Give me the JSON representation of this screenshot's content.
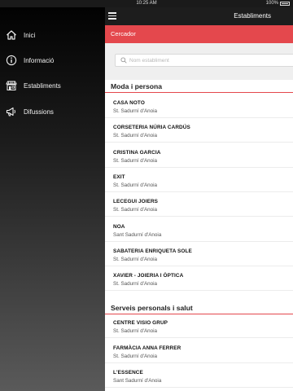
{
  "status_bar": {
    "time": "10:25 AM",
    "battery": "100%"
  },
  "sidebar": {
    "items": [
      {
        "label": "Inici",
        "icon": "home-icon"
      },
      {
        "label": "Informació",
        "icon": "info-icon"
      },
      {
        "label": "Establiments",
        "icon": "store-icon"
      },
      {
        "label": "Difussions",
        "icon": "megaphone-icon"
      }
    ]
  },
  "header": {
    "menu_icon": "hamburger-icon",
    "title": "Establiments"
  },
  "search_bar": {
    "title": "Cercador",
    "placeholder": "Nom establiment",
    "value": "",
    "icon": "search-icon"
  },
  "colors": {
    "accent": "#e4484d",
    "navbar": "#1d1d1d",
    "sidebar_top": "#020202",
    "sidebar_bottom": "#5a5a5a"
  },
  "sections": [
    {
      "title": "Moda i persona",
      "items": [
        {
          "name": "CASA NOTO",
          "location": "St. Sadurní d'Anoia"
        },
        {
          "name": "CORSETERIA NÚRIA CARDÚS",
          "location": "St. Sadurní d'Anoia"
        },
        {
          "name": "CRISTINA GARCIA",
          "location": "St. Sadurní d'Anoia"
        },
        {
          "name": "EXIT",
          "location": "St. Sadurní d'Anoia"
        },
        {
          "name": "LECEGUI JOIERS",
          "location": "St. Sadurní d'Anoia"
        },
        {
          "name": "NOA",
          "location": "Sant Sadurní d'Anoia"
        },
        {
          "name": "SABATERIA ENRIQUETA SOLE",
          "location": "St. Sadurní d'Anoia"
        },
        {
          "name": "XAVIER - JOIERIA I ÒPTICA",
          "location": "St. Sadurní d'Anoia"
        }
      ]
    },
    {
      "title": "Serveis personals i salut",
      "items": [
        {
          "name": "CENTRE VISIO GRUP",
          "location": "St. Sadurní d'Anoia"
        },
        {
          "name": "FARMÀCIA ANNA FERRER",
          "location": "St. Sadurní d'Anoia"
        },
        {
          "name": "L'ESSENCE",
          "location": "Sant Sadurní d'Anoia"
        }
      ]
    }
  ]
}
